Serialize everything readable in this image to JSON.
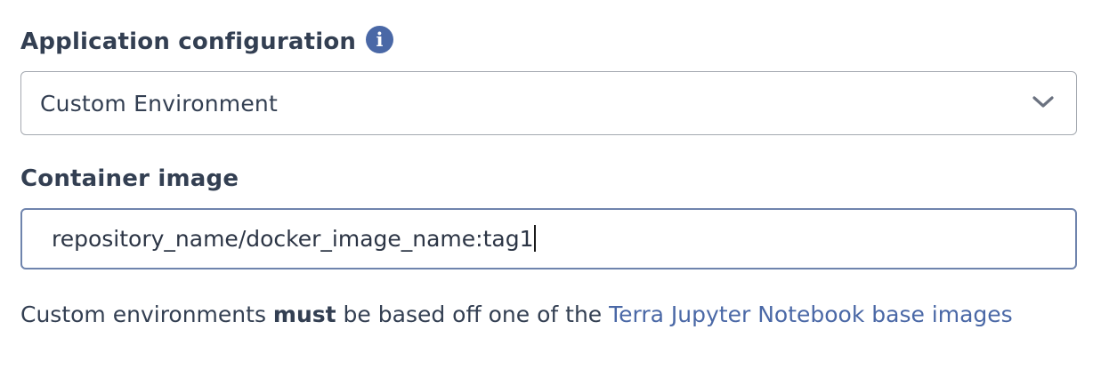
{
  "app_config": {
    "label": "Application configuration",
    "info_icon": "info-circle-icon",
    "selected_value": "Custom Environment",
    "dropdown_icon": "chevron-down-icon"
  },
  "container_image": {
    "label": "Container image",
    "value": "repository_name/docker_image_name:tag1"
  },
  "help": {
    "prefix": "Custom environments ",
    "emphasis": "must",
    "middle": " be based off one of the ",
    "link_text": "Terra Jupyter Notebook base images"
  },
  "colors": {
    "text": "#333f52",
    "accent": "#4a68a6",
    "border": "#a4a9b0",
    "focus_border": "#6f84ad"
  }
}
